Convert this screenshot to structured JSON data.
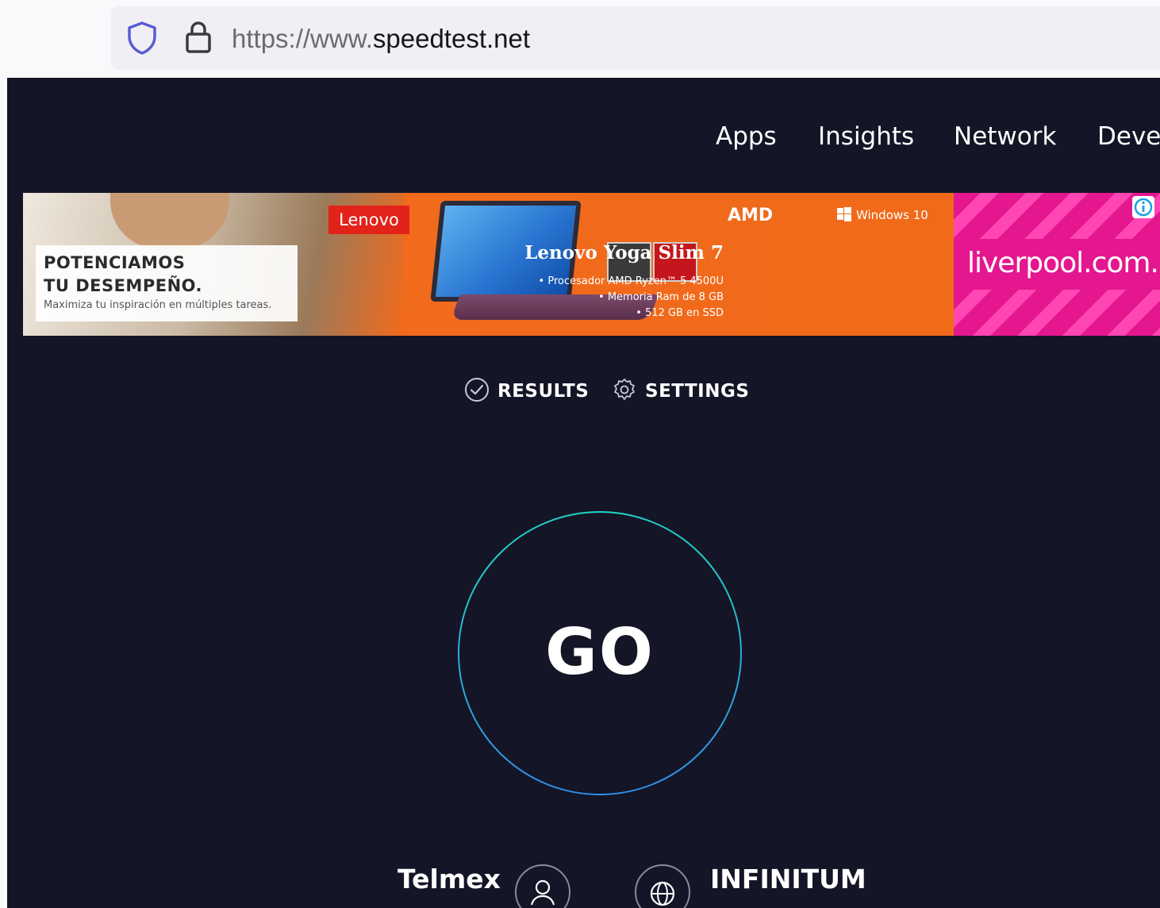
{
  "browser": {
    "url_prefix": "https://www.",
    "url_domain": "speedtest.net",
    "shield_icon": "shield-icon",
    "lock_icon": "lock-icon"
  },
  "nav": {
    "items": [
      {
        "label": "Apps"
      },
      {
        "label": "Insights"
      },
      {
        "label": "Network"
      },
      {
        "label": "Deve"
      }
    ]
  },
  "ad": {
    "headline_1": "POTENCIAMOS",
    "headline_2": "TU DESEMPEÑO.",
    "subline": "Maximiza tu inspiración en múltiples tareas.",
    "brand": "Lenovo",
    "amd": "AMD",
    "windows": "Windows 10",
    "product": "Lenovo Yoga Slim 7",
    "specs": [
      "• Procesador AMD Ryzen™ 5 4500U",
      "• Memoria Ram de 8 GB",
      "• 512 GB en SSD"
    ],
    "liverpool": "liverpool.com.m",
    "adchoices_icon": "info-icon",
    "colors": {
      "lenovo_orange": "#f06a1a",
      "lenovo_red": "#e2231a",
      "liverpool_pink": "#e4178f"
    }
  },
  "tabs": {
    "results": "RESULTS",
    "settings": "SETTINGS"
  },
  "go": {
    "label": "GO",
    "ring_colors": [
      "#1fd6c5",
      "#2f8fe8"
    ]
  },
  "provider": {
    "isp": "Telmex",
    "server": "INFINITUM"
  },
  "theme": {
    "background": "#141526",
    "text": "#ffffff"
  }
}
